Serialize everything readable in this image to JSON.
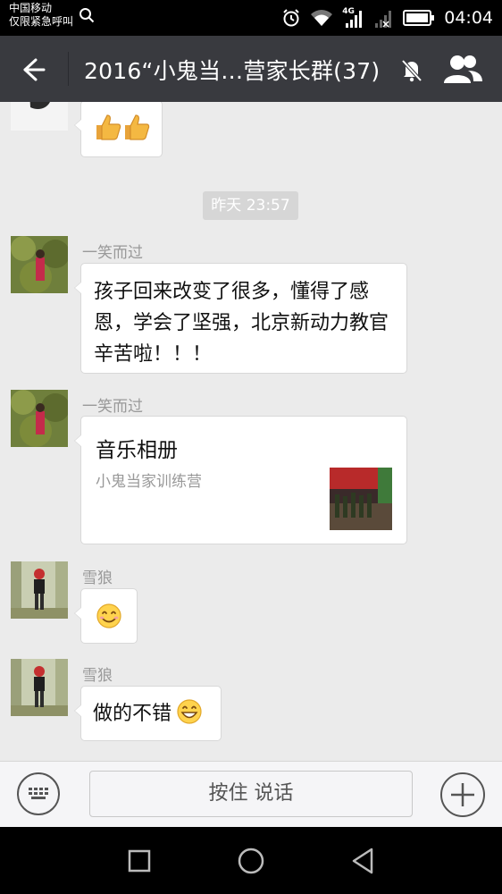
{
  "status_bar": {
    "carrier": "中国移动",
    "emergency": "仅限紧急呼叫",
    "network": "4G",
    "time": "04:04"
  },
  "header": {
    "title": "2016“小鬼当…营家长群(37)"
  },
  "messages": {
    "timestamp": "昨天 23:57",
    "items": [
      {
        "sender": "一笑而过",
        "text": "孩子回来改变了很多，懂得了感恩，学会了坚强，北京新动力教官辛苦啦！！！"
      },
      {
        "sender": "一笑而过",
        "card_title": "音乐相册",
        "card_subtitle": "小鬼当家训练营"
      },
      {
        "sender": "雪狼",
        "emoji": "smile-emoji"
      },
      {
        "sender": "雪狼",
        "text": "做的不错",
        "emoji": "grin-emoji"
      }
    ]
  },
  "input_bar": {
    "voice_label": "按住 说话"
  },
  "colors": {
    "title_bar_bg": "#393a3f",
    "chat_bg": "#ebebeb",
    "bubble_bg": "#ffffff",
    "sender_color": "#999999"
  }
}
